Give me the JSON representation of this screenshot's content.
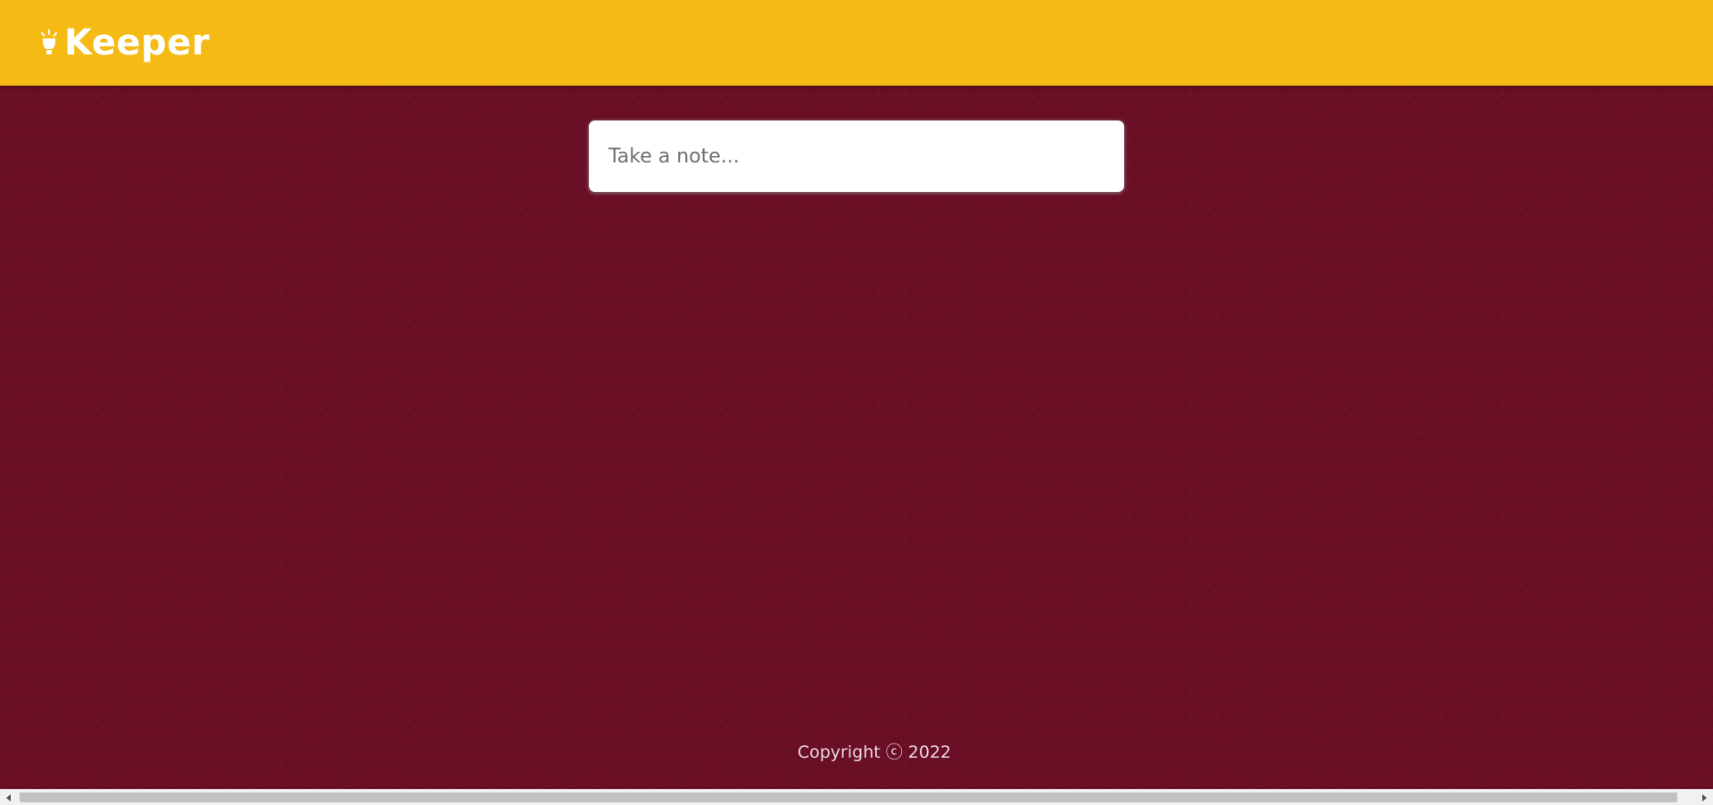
{
  "header": {
    "title": "Keeper",
    "logo_icon": "lightbulb-icon",
    "background_color": "#f5ba13"
  },
  "note_form": {
    "placeholder": "Take a note...",
    "value": ""
  },
  "footer": {
    "copyright": "Copyright ⓒ 2022"
  },
  "colors": {
    "page_background": "#6b0f26",
    "header_background": "#f5ba13",
    "text_on_header": "#ffffff"
  },
  "scrollbar": {
    "left_arrow_icon": "arrow-left-icon",
    "right_arrow_icon": "arrow-right-icon"
  }
}
